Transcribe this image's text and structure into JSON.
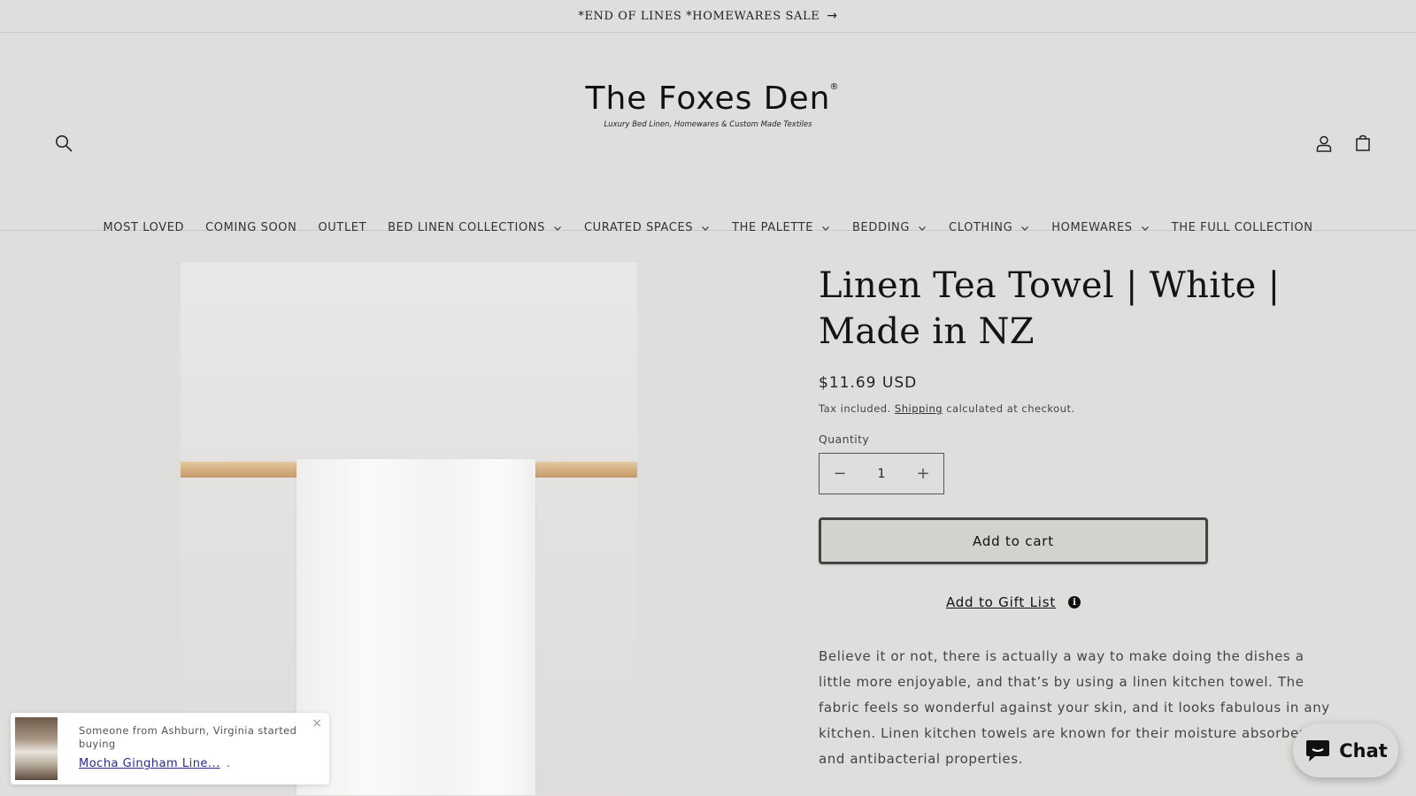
{
  "announcement": {
    "text": "*END OF LINES *HOMEWARES SALE",
    "arrow": "→"
  },
  "header": {
    "logo_title": "The Foxes Den",
    "logo_reg": "®",
    "logo_tagline": "Luxury Bed Linen, Homewares & Custom Made Textiles",
    "icons": [
      "search-icon",
      "account-icon",
      "cart-icon"
    ]
  },
  "nav": {
    "items": [
      {
        "label": "MOST LOVED",
        "dropdown": false
      },
      {
        "label": "COMING SOON",
        "dropdown": false
      },
      {
        "label": "OUTLET",
        "dropdown": false
      },
      {
        "label": "BED LINEN COLLECTIONS",
        "dropdown": true
      },
      {
        "label": "CURATED SPACES",
        "dropdown": true
      },
      {
        "label": "THE PALETTE",
        "dropdown": true
      },
      {
        "label": "BEDDING",
        "dropdown": true
      },
      {
        "label": "CLOTHING",
        "dropdown": true
      },
      {
        "label": "HOMEWARES",
        "dropdown": true
      },
      {
        "label": "THE FULL COLLECTION",
        "dropdown": false
      }
    ]
  },
  "product": {
    "title": "Linen Tea Towel | White | Made in NZ",
    "price": "$11.69 USD",
    "tax_prefix": "Tax included. ",
    "tax_link": "Shipping",
    "tax_suffix": " calculated at checkout.",
    "quantity_label": "Quantity",
    "quantity_value": "1",
    "decrease_symbol": "−",
    "increase_symbol": "+",
    "add_to_cart": "Add to cart",
    "gift_list": "Add to Gift List",
    "gift_info_symbol": "i",
    "description": "Believe it or not, there is actually a way to make doing the dishes a little more enjoyable, and that’s by using a linen kitchen towel. The fabric feels so wonderful against your skin, and it looks fabulous in any kitchen. Linen kitchen towels are known for their moisture absorbent and antibacterial properties."
  },
  "toast": {
    "message": "Someone from Ashburn, Virginia started buying",
    "product": "Mocha Gingham Line...",
    "suffix": ".",
    "close": "×"
  },
  "chat": {
    "label": "Chat"
  },
  "colors": {
    "background": "#dededc",
    "text": "#222222",
    "button_border": "#444444",
    "toast_link": "#2a2a8a"
  }
}
